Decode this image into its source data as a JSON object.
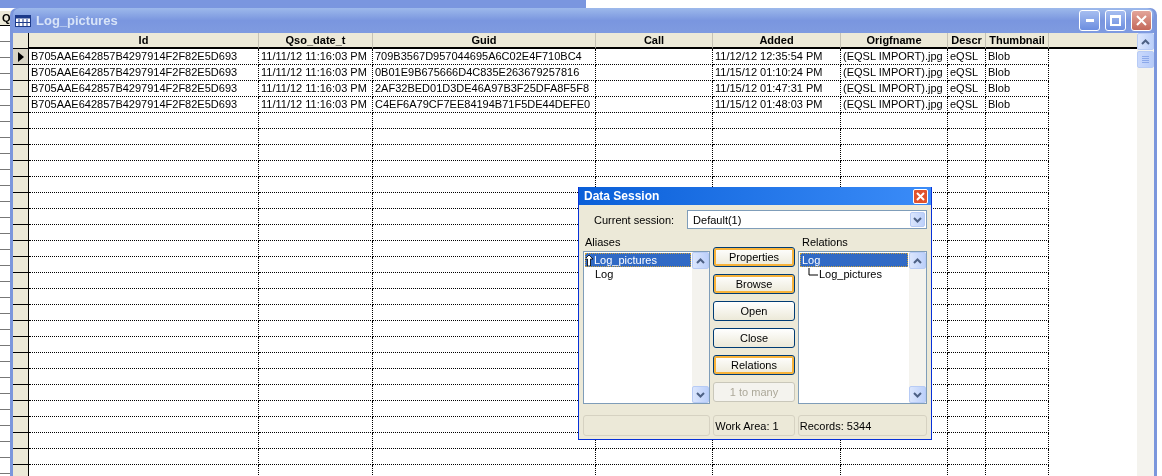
{
  "back_window": {
    "column_header": "Q"
  },
  "window": {
    "title": "Log_pictures",
    "active": false
  },
  "table": {
    "columns": [
      "Id",
      "Qso_date_t",
      "Guid",
      "Call",
      "Added",
      "Origfname",
      "Descr",
      "Thumbnail"
    ],
    "rows": [
      {
        "current": true,
        "cells": [
          "B705AAE642857B4297914F2F82E5D693",
          "11/11/12 11:16:03 PM",
          "709B3567D957044695A6C02E4F710BC4",
          "",
          "11/12/12 12:35:54 PM",
          "(EQSL IMPORT).jpg",
          "eQSL",
          "Blob"
        ]
      },
      {
        "current": false,
        "cells": [
          "B705AAE642857B4297914F2F82E5D693",
          "11/11/12 11:16:03 PM",
          "0B01E9B675666D4C835E263679257816",
          "",
          "11/15/12 01:10:24 PM",
          "(EQSL IMPORT).jpg",
          "eQSL",
          "Blob"
        ]
      },
      {
        "current": false,
        "cells": [
          "B705AAE642857B4297914F2F82E5D693",
          "11/11/12 11:16:03 PM",
          "2AF32BED01D3DE46A97B3F25DFA8F5F8",
          "",
          "11/15/12 01:47:31 PM",
          "(EQSL IMPORT).jpg",
          "eQSL",
          "Blob"
        ]
      },
      {
        "current": false,
        "cells": [
          "B705AAE642857B4297914F2F82E5D693",
          "11/11/12 11:16:03 PM",
          "C4EF6A79CF7EE84194B71F5DE44DEFE0",
          "",
          "11/15/12 01:48:03 PM",
          "(EQSL IMPORT).jpg",
          "eQSL",
          "Blob"
        ]
      }
    ]
  },
  "dialog": {
    "title": "Data Session",
    "session_label": "Current session:",
    "session_value": "Default(1)",
    "aliases_label": "Aliases",
    "aliases": [
      {
        "label": "Log_pictures",
        "selected": true,
        "marker": true
      },
      {
        "label": "Log",
        "selected": false,
        "marker": false
      }
    ],
    "relations_label": "Relations",
    "relations": [
      {
        "label": "Log",
        "selected": true,
        "children": [
          {
            "label": "Log_pictures",
            "selected": false
          }
        ]
      }
    ],
    "buttons": [
      {
        "label": "Properties",
        "highlighted": true,
        "disabled": false
      },
      {
        "label": "Browse",
        "highlighted": true,
        "disabled": false
      },
      {
        "label": "Open",
        "highlighted": false,
        "disabled": false
      },
      {
        "label": "Close",
        "highlighted": false,
        "disabled": false
      },
      {
        "label": "Relations",
        "highlighted": true,
        "disabled": false
      },
      {
        "label": "1 to many",
        "highlighted": false,
        "disabled": true
      }
    ],
    "status_bar": {
      "work_area": "Work Area: 1",
      "records": "Records: 5344"
    }
  }
}
